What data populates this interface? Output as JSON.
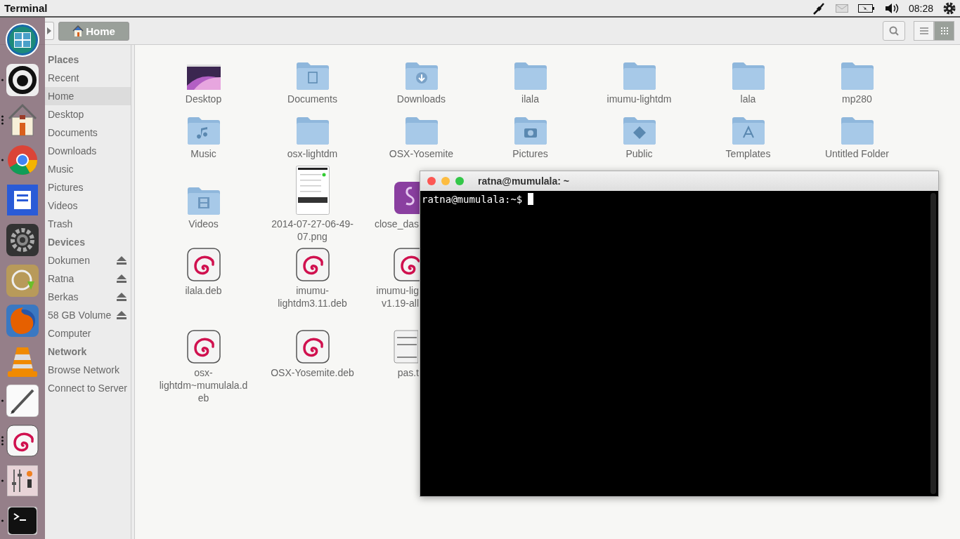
{
  "top_bar": {
    "app_name": "Terminal",
    "clock": "08:28"
  },
  "toolbar": {
    "path": [
      {
        "label": "Home",
        "selected": true
      }
    ],
    "view_modes": [
      {
        "kind": "list",
        "selected": false
      },
      {
        "kind": "grid",
        "selected": true
      }
    ]
  },
  "sidebar": {
    "sections": [
      {
        "heading": "Places",
        "items": [
          {
            "label": "Recent",
            "selected": false
          },
          {
            "label": "Home",
            "selected": true
          },
          {
            "label": "Desktop",
            "selected": false
          },
          {
            "label": "Documents",
            "selected": false
          },
          {
            "label": "Downloads",
            "selected": false
          },
          {
            "label": "Music",
            "selected": false
          },
          {
            "label": "Pictures",
            "selected": false
          },
          {
            "label": "Videos",
            "selected": false
          },
          {
            "label": "Trash",
            "selected": false
          }
        ]
      },
      {
        "heading": "Devices",
        "items": [
          {
            "label": "Dokumen",
            "selected": false,
            "ejectable": true
          },
          {
            "label": "Ratna",
            "selected": false,
            "ejectable": true
          },
          {
            "label": "Berkas",
            "selected": false,
            "ejectable": true
          },
          {
            "label": "58 GB Volume",
            "selected": false,
            "ejectable": true
          },
          {
            "label": "Computer",
            "selected": false,
            "ejectable": false
          }
        ]
      },
      {
        "heading": "Network",
        "items": [
          {
            "label": "Browse Network",
            "selected": false
          },
          {
            "label": "Connect to Server",
            "selected": false
          }
        ]
      }
    ]
  },
  "file_rows": [
    [
      {
        "label": "Desktop",
        "kind": "wallpaper"
      },
      {
        "label": "Documents",
        "kind": "documents"
      },
      {
        "label": "Downloads",
        "kind": "downloads"
      },
      {
        "label": "ilala",
        "kind": "folder"
      },
      {
        "label": "imumu-lightdm",
        "kind": "folder"
      },
      {
        "label": "lala",
        "kind": "folder"
      },
      {
        "label": "mp280",
        "kind": "folder"
      }
    ],
    [
      {
        "label": "Music",
        "kind": "music"
      },
      {
        "label": "osx-lightdm",
        "kind": "folder"
      },
      {
        "label": "OSX-Yosemite",
        "kind": "folder"
      },
      {
        "label": "Pictures",
        "kind": "pictures"
      },
      {
        "label": "Public",
        "kind": "public"
      },
      {
        "label": "Templates",
        "kind": "templates"
      },
      {
        "label": "Untitled Folder",
        "kind": "folder"
      }
    ],
    [
      {
        "label": "Videos",
        "kind": "videos",
        "cut": false
      },
      {
        "label": "2014-07-27-06-49-07.png",
        "kind": "screenshot",
        "cut": false
      },
      {
        "label": "close_das",
        "kind": "script",
        "cut": true
      }
    ],
    [
      {
        "label": "ilala.deb",
        "kind": "deb",
        "cut": false
      },
      {
        "label": "imumu-lightdm3.11.deb",
        "kind": "deb",
        "cut": false
      },
      {
        "label": "imumu-lig v1.19-all",
        "kind": "deb",
        "cut": true
      }
    ],
    [
      {
        "label": "osx-lightdm~mumulala.deb",
        "kind": "deb",
        "cut": false
      },
      {
        "label": "OSX-Yosemite.deb",
        "kind": "deb",
        "cut": false
      },
      {
        "label": "pas.t",
        "kind": "text",
        "cut": true
      }
    ]
  ],
  "terminal": {
    "title": "ratna@mumulala: ~",
    "prompt": "ratna@mumulala:~$"
  },
  "dock": [
    {
      "kind": "mml",
      "running": false,
      "several_windows": false
    },
    {
      "kind": "ring",
      "running": true,
      "several_windows": false
    },
    {
      "kind": "home",
      "running": true,
      "several_windows": true
    },
    {
      "kind": "chrome",
      "running": true,
      "several_windows": false
    },
    {
      "kind": "writer",
      "running": false,
      "several_windows": false
    },
    {
      "kind": "settings",
      "running": false,
      "several_windows": false
    },
    {
      "kind": "installer",
      "running": false,
      "several_windows": false
    },
    {
      "kind": "firefox",
      "running": false,
      "several_windows": false
    },
    {
      "kind": "vlc",
      "running": false,
      "several_windows": false
    },
    {
      "kind": "editor",
      "running": true,
      "several_windows": false
    },
    {
      "kind": "debian",
      "running": true,
      "several_windows": true
    },
    {
      "kind": "mixer",
      "running": true,
      "several_windows": false
    },
    {
      "kind": "terminal",
      "running": true,
      "several_windows": false
    }
  ]
}
